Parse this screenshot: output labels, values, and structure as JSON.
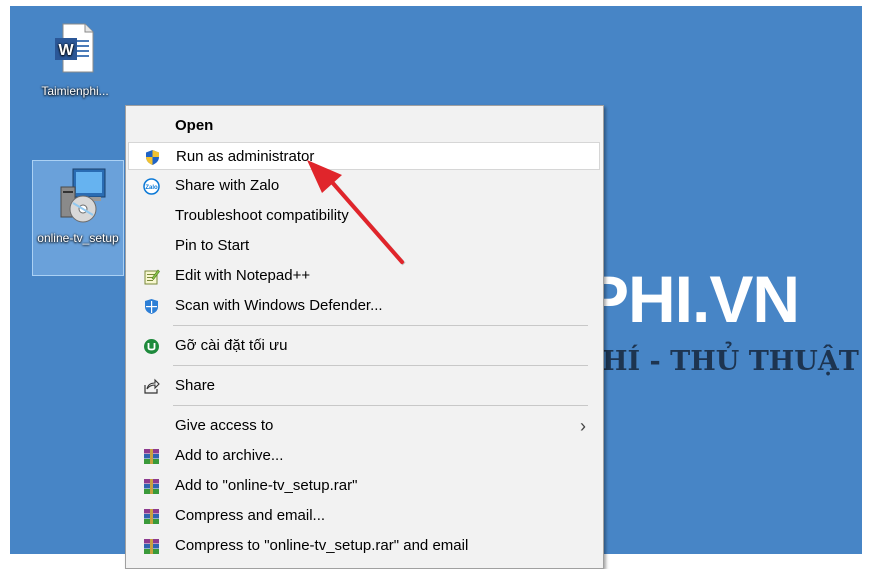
{
  "desktop": {
    "watermark_big": "PHI.VN",
    "watermark_small": "HÍ - THỦ THUẬT",
    "icons": [
      {
        "label": "Taimienphi...",
        "icon": "word-document-icon"
      },
      {
        "label": "online-tv_setup",
        "icon": "installer-icon"
      }
    ]
  },
  "context_menu": {
    "items": [
      {
        "label": "Open",
        "icon": "none"
      },
      {
        "label": "Run as administrator",
        "icon": "uac-shield-icon"
      },
      {
        "label": "Share with Zalo",
        "icon": "zalo-icon"
      },
      {
        "label": "Troubleshoot compatibility",
        "icon": "none"
      },
      {
        "label": "Pin to Start",
        "icon": "none"
      },
      {
        "label": "Edit with Notepad++",
        "icon": "notepad-plus-plus-icon"
      },
      {
        "label": "Scan with Windows Defender...",
        "icon": "windows-defender-icon"
      },
      {
        "label": "Gỡ cài đặt tối ưu",
        "icon": "uninstaller-icon"
      },
      {
        "label": "Share",
        "icon": "share-icon"
      },
      {
        "label": "Give access to",
        "icon": "none"
      },
      {
        "label": "Add to archive...",
        "icon": "winrar-icon"
      },
      {
        "label": "Add to \"online-tv_setup.rar\"",
        "icon": "winrar-icon"
      },
      {
        "label": "Compress and email...",
        "icon": "winrar-icon"
      },
      {
        "label": "Compress to \"online-tv_setup.rar\" and email",
        "icon": "winrar-icon"
      }
    ],
    "submenu_chevron": "›"
  },
  "colors": {
    "desktop_bg": "#4785c6",
    "menu_bg": "#f2f2f2",
    "highlight_bg": "#ffffff",
    "arrow": "#e0252b"
  }
}
